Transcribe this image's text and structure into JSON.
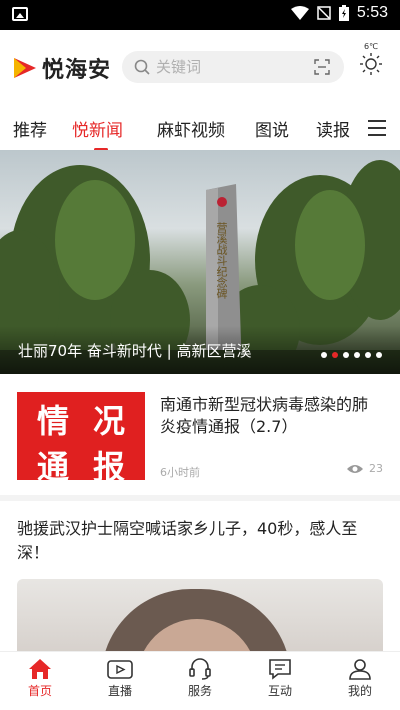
{
  "status_bar": {
    "time": "5:53"
  },
  "header": {
    "app_name": "悦海安",
    "search_placeholder": "关键词",
    "weather_temp": "6℃"
  },
  "nav": {
    "tabs": [
      {
        "label": "推荐"
      },
      {
        "label": "悦新闻",
        "active": true
      },
      {
        "label": "麻虾视频"
      },
      {
        "label": "图说"
      },
      {
        "label": "读报"
      }
    ]
  },
  "banner": {
    "caption": "壮丽70年 奋斗新时代 | 高新区营溪",
    "monument_text": "营溪战斗纪念碑",
    "slide_count": 6,
    "active_slide": 2
  },
  "news_card": {
    "thumb_text": [
      "情",
      "况",
      "通",
      "报"
    ],
    "title": "南通市新型冠状病毒感染的肺炎疫情通报（2.7）",
    "time": "6小时前",
    "views": "23"
  },
  "article": {
    "title": "驰援武汉护士隔空喊话家乡儿子，40秒，感人至深！"
  },
  "tabbar": {
    "items": [
      {
        "label": "首页",
        "icon": "home-icon",
        "active": true
      },
      {
        "label": "直播",
        "icon": "live-icon"
      },
      {
        "label": "服务",
        "icon": "service-icon"
      },
      {
        "label": "互动",
        "icon": "chat-icon"
      },
      {
        "label": "我的",
        "icon": "profile-icon"
      }
    ]
  },
  "colors": {
    "accent": "#e62828",
    "thumb_red": "#e02020"
  }
}
